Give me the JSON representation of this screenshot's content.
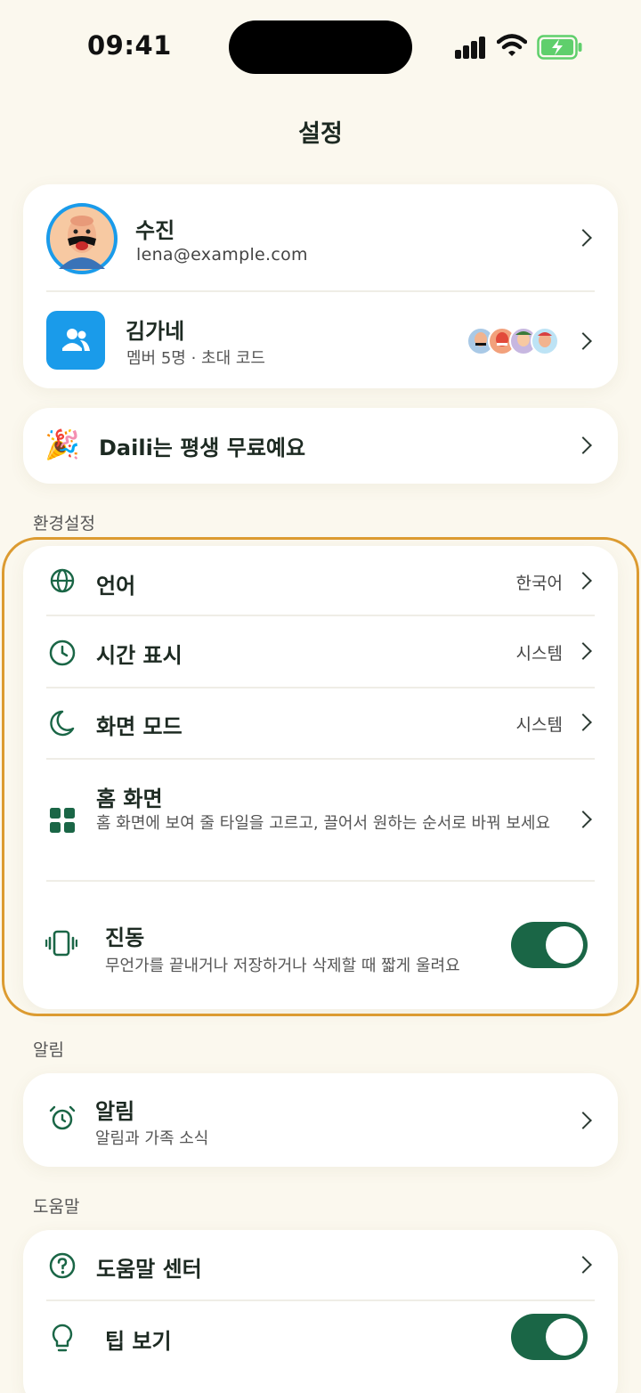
{
  "status": {
    "time": "09:41"
  },
  "page": {
    "title": "설정"
  },
  "profile": {
    "name": "수진",
    "email": "lena@example.com"
  },
  "family": {
    "name": "김가네",
    "meta": "멤버 5명 · 초대 코드"
  },
  "promo": {
    "emoji": "🎉",
    "text": "Daili는 평생 무료예요"
  },
  "preferences": {
    "label": "환경설정",
    "language": {
      "title": "언어",
      "value": "한국어"
    },
    "time_display": {
      "title": "시간 표시",
      "value": "시스템"
    },
    "display_mode": {
      "title": "화면 모드",
      "value": "시스템"
    },
    "home_screen": {
      "title": "홈 화면",
      "desc": "홈 화면에 보여 줄 타일을 고르고, 끌어서 원하는 순서로 바꿔 보세요"
    },
    "vibration": {
      "title": "진동",
      "desc": "무언가를 끝내거나 저장하거나 삭제할 때 짧게 울려요",
      "enabled": true
    }
  },
  "notifications": {
    "label": "알림",
    "alerts": {
      "title": "알림",
      "desc": "알림과 가족 소식"
    }
  },
  "help": {
    "label": "도움말",
    "help_center": {
      "title": "도움말 센터"
    },
    "tips": {
      "title": "팁 보기",
      "enabled": true
    }
  },
  "colors": {
    "accent": "#1a6646",
    "background": "#fbf8ee",
    "highlight": "#dc9b31",
    "family_icon_bg": "#1a9bea"
  }
}
